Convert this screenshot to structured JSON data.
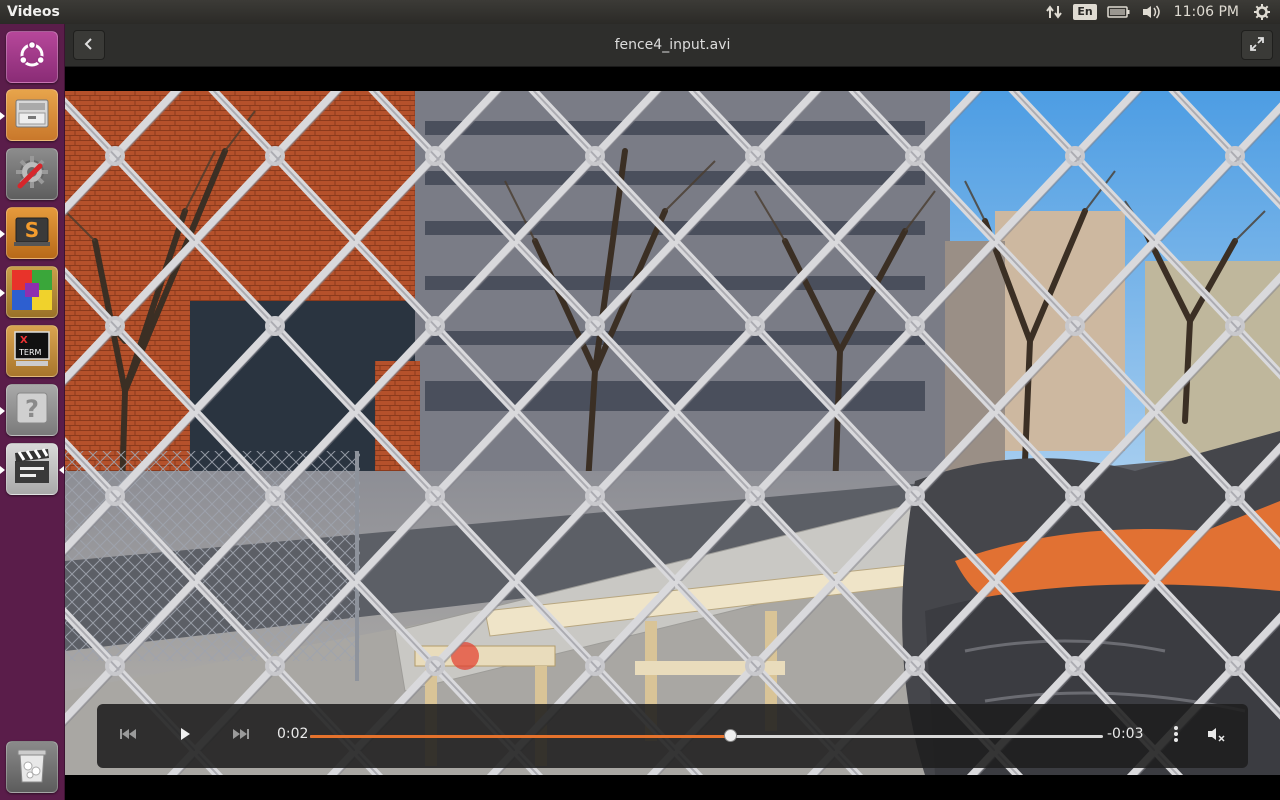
{
  "top_panel": {
    "app_title": "Videos",
    "keyboard_layout": "En",
    "clock": "11:06 PM",
    "icons": [
      "network-transfer-icon",
      "battery-icon",
      "volume-icon",
      "session-gear-icon"
    ]
  },
  "launcher": {
    "items": [
      {
        "name": "ubuntu-dash",
        "icon": "ubuntu-logo-icon"
      },
      {
        "name": "files",
        "icon": "file-cabinet-icon"
      },
      {
        "name": "system-settings",
        "icon": "settings-wrench-icon"
      },
      {
        "name": "sublime-text",
        "icon": "sublime-text-icon"
      },
      {
        "name": "color-app",
        "icon": "color-grid-icon"
      },
      {
        "name": "xterm",
        "icon": "xterm-icon",
        "label": "X TERM"
      },
      {
        "name": "unknown-app",
        "icon": "question-mark-icon",
        "label": "?"
      },
      {
        "name": "videos",
        "icon": "clapperboard-icon"
      },
      {
        "name": "trash",
        "icon": "trash-icon"
      }
    ]
  },
  "header": {
    "file_title": "fence4_input.avi",
    "back_icon": "chevron-left-icon",
    "fullscreen_icon": "fullscreen-icon"
  },
  "player": {
    "elapsed": "0:02",
    "remaining": "-0:03",
    "progress_fraction": 0.53,
    "accent_color": "#e5722c",
    "icons": [
      "skip-back-icon",
      "play-icon",
      "skip-forward-icon",
      "more-vertical-icon",
      "volume-muted-icon"
    ]
  }
}
